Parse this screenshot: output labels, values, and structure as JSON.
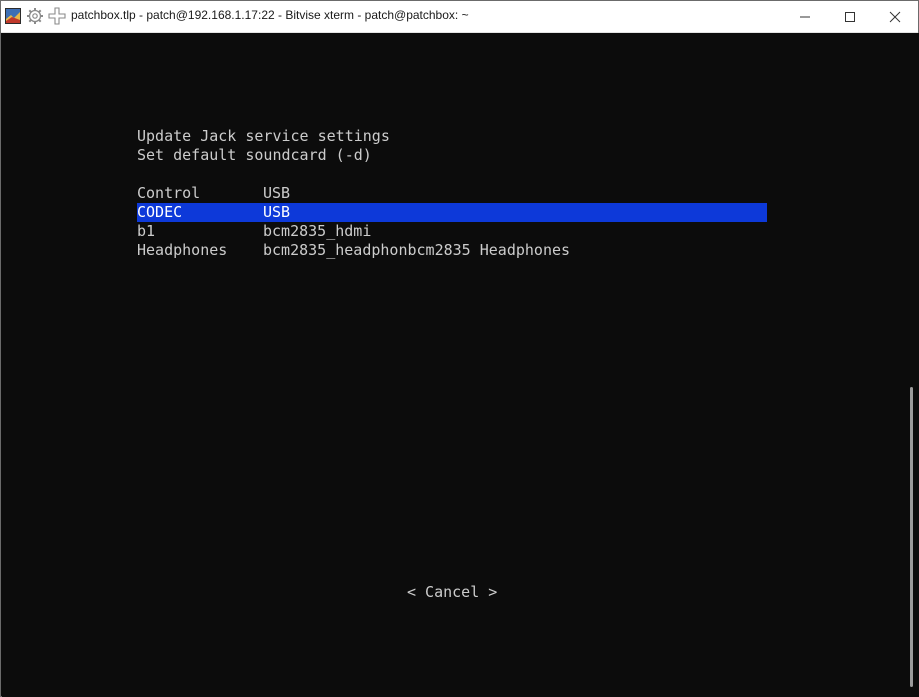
{
  "window": {
    "title": "patchbox.tlp - patch@192.168.1.17:22 - Bitvise xterm - patch@patchbox: ~",
    "icons": [
      "app-icon",
      "gear-icon",
      "move-icon"
    ],
    "controls": [
      "minimize-icon",
      "maximize-icon",
      "close-icon"
    ]
  },
  "dialog": {
    "heading": "Update Jack service settings",
    "prompt": "Set default soundcard (-d)",
    "menu": [
      {
        "tag": "Control",
        "item": "USB",
        "selected": false
      },
      {
        "tag": "CODEC",
        "item": "USB",
        "selected": true
      },
      {
        "tag": "b1",
        "item": "bcm2835_hdmi",
        "selected": false
      },
      {
        "tag": "Headphones",
        "item": "bcm2835_headphonbcm2835 Headphones",
        "selected": false
      }
    ],
    "cancel_button": "< Cancel >"
  },
  "colors": {
    "terminal_bg": "#0c0c0c",
    "text": "#cccccc",
    "selection": "#0d39d9"
  }
}
